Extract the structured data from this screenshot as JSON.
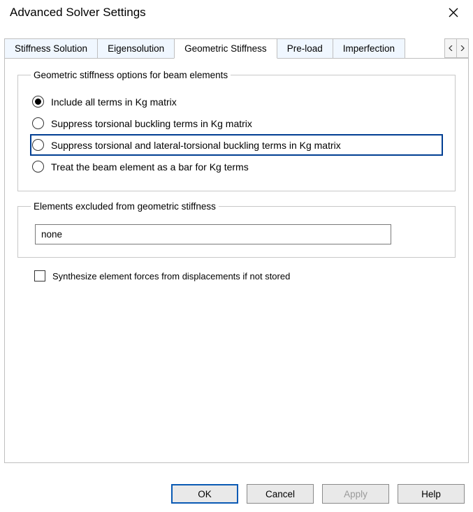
{
  "window": {
    "title": "Advanced Solver Settings"
  },
  "tabs": {
    "t0": "Stiffness Solution",
    "t1": "Eigensolution",
    "t2": "Geometric Stiffness",
    "t3": "Pre-load",
    "t4": "Imperfection"
  },
  "group_geom": {
    "legend": "Geometric stiffness options for beam elements",
    "opt0": "Include all terms in Kg matrix",
    "opt1": "Suppress torsional buckling terms in Kg matrix",
    "opt2": "Suppress torsional and lateral-torsional buckling terms in Kg matrix",
    "opt3": "Treat the beam element as a bar for Kg terms"
  },
  "group_excl": {
    "legend": "Elements excluded from geometric stiffness",
    "value": "none"
  },
  "synth_check": {
    "label": "Synthesize element forces from displacements if not stored"
  },
  "buttons": {
    "ok": "OK",
    "cancel": "Cancel",
    "apply": "Apply",
    "help": "Help"
  }
}
